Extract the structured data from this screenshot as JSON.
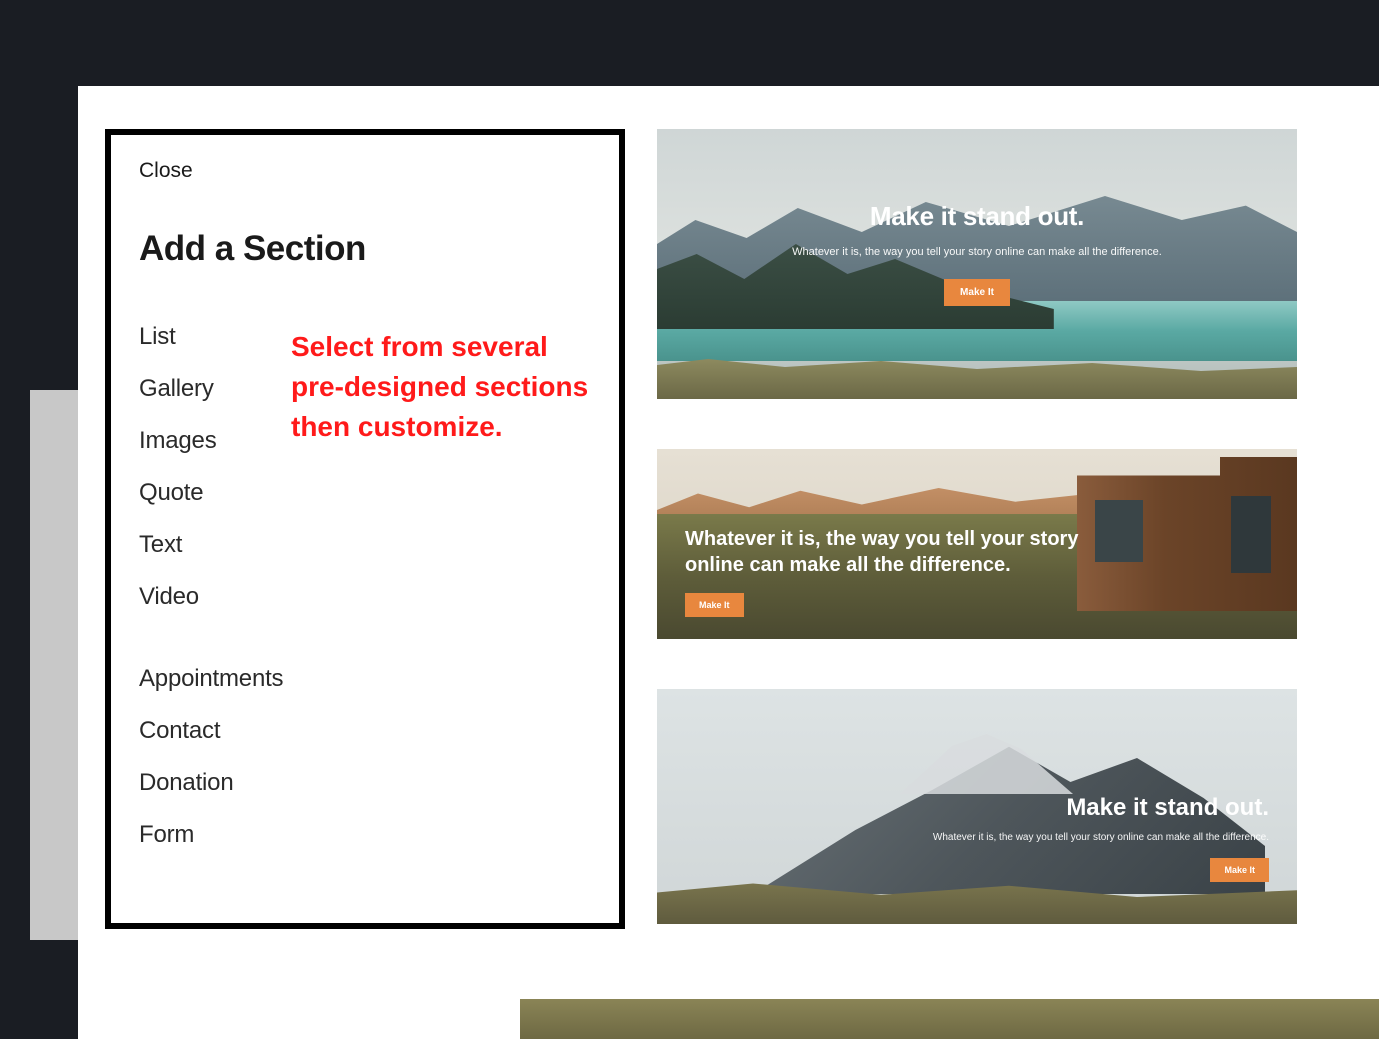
{
  "panel": {
    "close_label": "Close",
    "title": "Add a Section",
    "group1": [
      {
        "label": "List"
      },
      {
        "label": "Gallery"
      },
      {
        "label": "Images"
      },
      {
        "label": "Quote"
      },
      {
        "label": "Text"
      },
      {
        "label": "Video"
      }
    ],
    "group2": [
      {
        "label": "Appointments"
      },
      {
        "label": "Contact"
      },
      {
        "label": "Donation"
      },
      {
        "label": "Form"
      }
    ]
  },
  "annotation": {
    "text": "Select from several pre-designed sections then customize."
  },
  "previews": [
    {
      "title": "Make it stand out.",
      "subtitle": "Whatever it is, the way you tell your story online can make all the difference.",
      "button": "Make It"
    },
    {
      "title": "Whatever it is, the way you tell your story online can make all the difference.",
      "button": "Make It"
    },
    {
      "title": "Make it stand out.",
      "subtitle": "Whatever it is, the way you tell your story online can make all the difference.",
      "button": "Make It"
    }
  ],
  "colors": {
    "accent": "#e8873e",
    "annotation": "#ff1a1a",
    "panel_border": "#000000"
  }
}
